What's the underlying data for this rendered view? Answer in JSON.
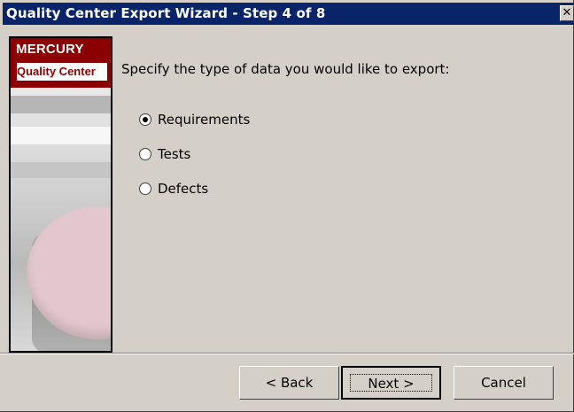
{
  "window": {
    "title": "Quality Center Export Wizard - Step 4 of 8",
    "close_glyph": "✕"
  },
  "sidebar": {
    "brand": "MERCURY",
    "product": "Quality Center"
  },
  "content": {
    "instruction": "Specify the type of data you would like to export:",
    "options": [
      {
        "label": "Requirements",
        "selected": true
      },
      {
        "label": "Tests",
        "selected": false
      },
      {
        "label": "Defects",
        "selected": false
      }
    ]
  },
  "footer": {
    "back_label": "< Back",
    "next_label": "Next >",
    "cancel_label": "Cancel"
  },
  "colors": {
    "titlebar": "#0a246a",
    "brand": "#8b0000",
    "dialog_bg": "#d4d0c8"
  },
  "icons": {
    "close": "close-icon",
    "radio": "radio-icon"
  }
}
